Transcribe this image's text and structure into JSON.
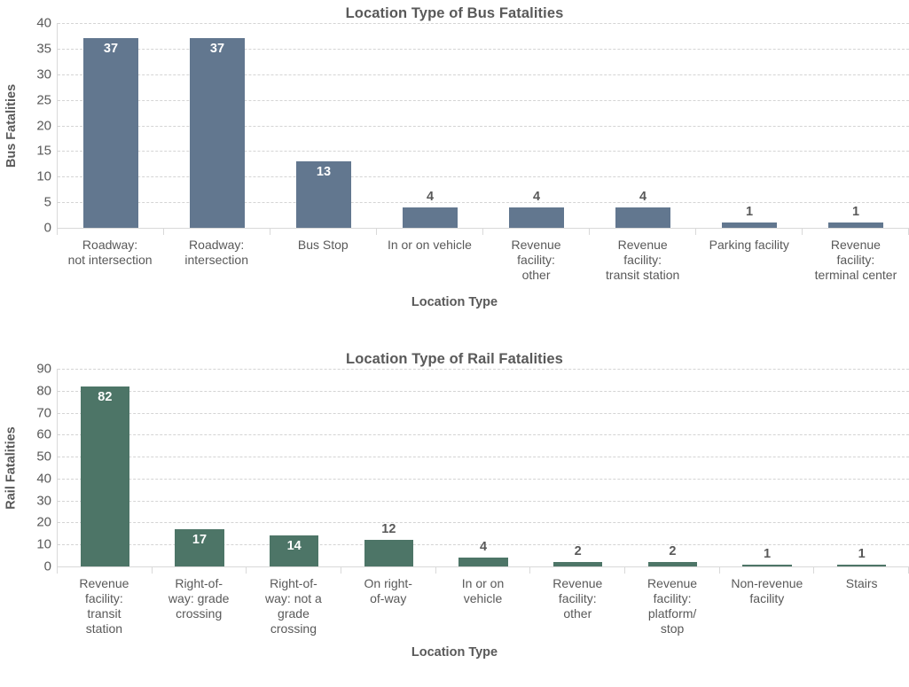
{
  "charts": [
    {
      "id": "bus",
      "title": "Location Type of Bus Fatalities",
      "ylabel": "Bus Fatalities",
      "xlabel": "Location Type",
      "bar_color": "#62778f",
      "label_color_inside": "#ffffff",
      "label_color_outside": "#595959",
      "grid_color": "#d4d4d4",
      "axis_color": "#d9d9d9"
    },
    {
      "id": "rail",
      "title": "Location Type of Rail Fatalities",
      "ylabel": "Rail Fatalities",
      "xlabel": "Location Type",
      "bar_color": "#4d7567",
      "label_color_inside": "#ffffff",
      "label_color_outside": "#595959",
      "grid_color": "#d4d4d4",
      "axis_color": "#d9d9d9"
    }
  ],
  "chart_data": [
    {
      "type": "bar",
      "title": "Location Type of Bus Fatalities",
      "xlabel": "Location Type",
      "ylabel": "Bus Fatalities",
      "ylim": [
        0,
        40
      ],
      "yticks": [
        0,
        5,
        10,
        15,
        20,
        25,
        30,
        35,
        40
      ],
      "grid": true,
      "legend": "none",
      "color": "#62778f",
      "categories": [
        "Roadway:\nnot intersection",
        "Roadway:\nintersection",
        "Bus Stop",
        "In or on vehicle",
        "Revenue\nfacility:\nother",
        "Revenue\nfacility:\ntransit station",
        "Parking facility",
        "Revenue\nfacility:\nterminal center"
      ],
      "values": [
        37,
        37,
        13,
        4,
        4,
        4,
        1,
        1
      ],
      "data_labels": [
        "37",
        "37",
        "13",
        "4",
        "4",
        "4",
        "1",
        "1"
      ]
    },
    {
      "type": "bar",
      "title": "Location Type of Rail Fatalities",
      "xlabel": "Location Type",
      "ylabel": "Rail Fatalities",
      "ylim": [
        0,
        90
      ],
      "yticks": [
        0,
        10,
        20,
        30,
        40,
        50,
        60,
        70,
        80,
        90
      ],
      "grid": true,
      "legend": "none",
      "color": "#4d7567",
      "categories": [
        "Revenue\nfacility:\ntransit\nstation",
        "Right-of-\nway: grade\ncrossing",
        "Right-of-\nway: not a\ngrade\ncrossing",
        "On right-\nof-way",
        "In or on\nvehicle",
        "Revenue\nfacility:\nother",
        "Revenue\nfacility:\nplatform/\nstop",
        "Non-revenue\nfacility",
        "Stairs"
      ],
      "values": [
        82,
        17,
        14,
        12,
        4,
        2,
        2,
        1,
        1
      ],
      "data_labels": [
        "82",
        "17",
        "14",
        "12",
        "4",
        "2",
        "2",
        "1",
        "1"
      ]
    }
  ]
}
